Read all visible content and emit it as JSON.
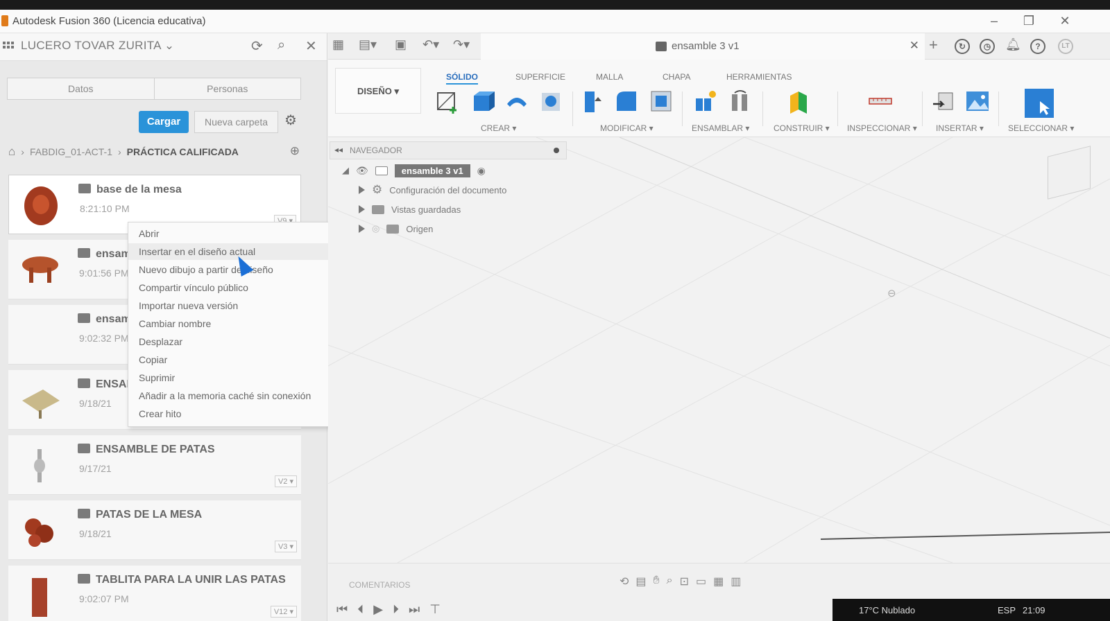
{
  "window": {
    "title": "Autodesk Fusion 360 (Licencia educativa)"
  },
  "data_panel": {
    "user_name": "LUCERO TOVAR ZURITA",
    "tabs": [
      "Datos",
      "Personas"
    ],
    "upload_label": "Cargar",
    "new_folder_label": "Nueva carpeta",
    "breadcrumb": [
      "FABDIG_01-ACT-1",
      "PRÁCTICA CALIFICADA"
    ],
    "files": [
      {
        "name": "base de la mesa",
        "date": "8:21:10 PM",
        "version": "V9"
      },
      {
        "name": "ensaml",
        "date": "9:01:56 PM",
        "version": ""
      },
      {
        "name": "ensaml",
        "date": "9:02:32 PM",
        "version": ""
      },
      {
        "name": "ENSAM",
        "date": "9/18/21",
        "version": ""
      },
      {
        "name": "ENSAMBLE DE PATAS",
        "date": "9/17/21",
        "version": "V2"
      },
      {
        "name": "PATAS DE LA MESA",
        "date": "9/18/21",
        "version": "V3"
      },
      {
        "name": "TABLITA PARA LA UNIR LAS PATAS",
        "date": "9:02:07 PM",
        "version": "V12"
      }
    ]
  },
  "context_menu": {
    "items": [
      "Abrir",
      "Insertar en el diseño actual",
      "Nuevo dibujo a partir de diseño",
      "Compartir vínculo público",
      "Importar nueva versión",
      "Cambiar nombre",
      "Desplazar",
      "Copiar",
      "Suprimir",
      "Añadir a la memoria caché sin conexión",
      "Crear hito"
    ]
  },
  "document": {
    "tab_name": "ensamble 3 v1"
  },
  "ribbon": {
    "workspace": "DISEÑO",
    "tabs": [
      "SÓLIDO",
      "SUPERFICIE",
      "MALLA",
      "CHAPA",
      "HERRAMIENTAS"
    ],
    "groups": [
      "CREAR",
      "MODIFICAR",
      "ENSAMBLAR",
      "CONSTRUIR",
      "INSPECCIONAR",
      "INSERTAR",
      "SELECCIONAR"
    ]
  },
  "navigator": {
    "title": "NAVEGADOR",
    "root": "ensamble 3 v1",
    "items": [
      "Configuración del documento",
      "Vistas guardadas",
      "Origen"
    ]
  },
  "bottom": {
    "comments_label": "COMENTARIOS"
  },
  "taskbar": {
    "weather": "17°C Nublado",
    "lang": "ESP",
    "time": "21:09"
  },
  "user_initials": "LT",
  "colors": {
    "accent": "#2a93d9",
    "upload_button": "#2a93d9"
  }
}
